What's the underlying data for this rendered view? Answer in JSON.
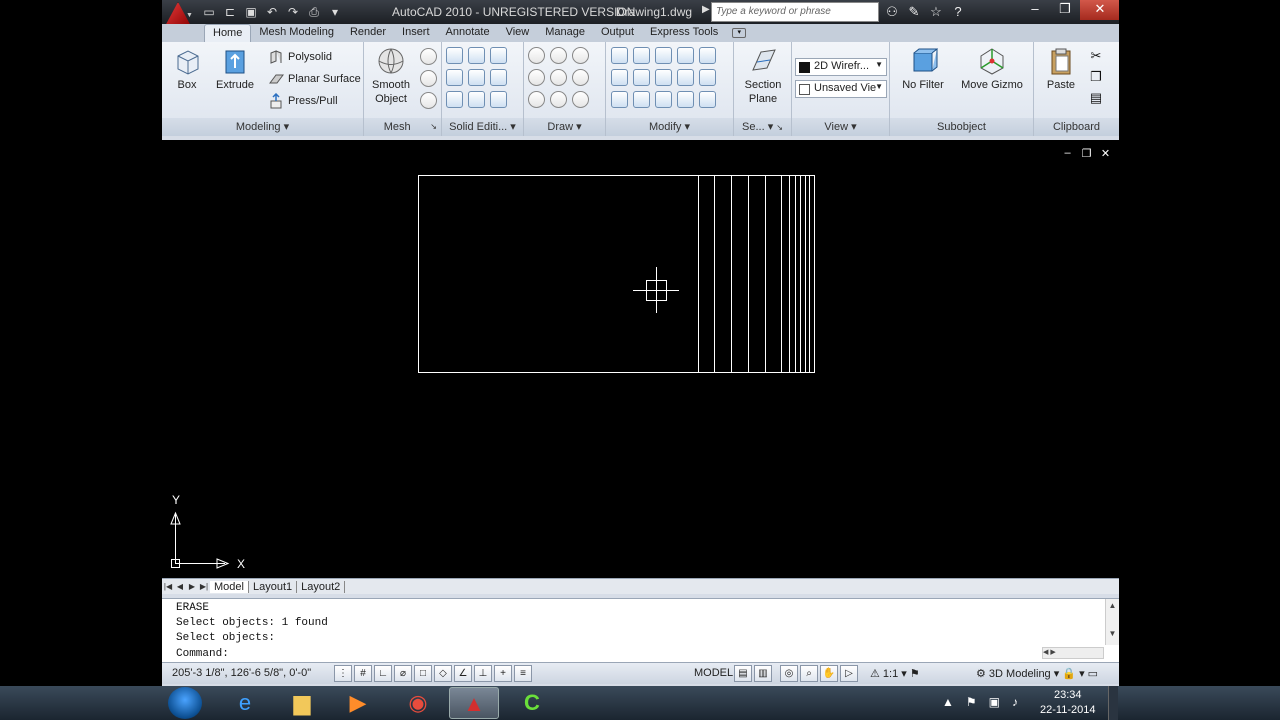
{
  "window": {
    "title": "AutoCAD 2010 - UNREGISTERED VERSION",
    "document": "Drawing1.dwg",
    "search_placeholder": "Type a keyword or phrase"
  },
  "tabs": [
    "Home",
    "Mesh Modeling",
    "Render",
    "Insert",
    "Annotate",
    "View",
    "Manage",
    "Output",
    "Express Tools"
  ],
  "ribbon": {
    "modeling": {
      "box": "Box",
      "extrude": "Extrude",
      "polysolid": "Polysolid",
      "planar_surface": "Planar Surface",
      "press_pull": "Press/Pull",
      "title": "Modeling"
    },
    "mesh": {
      "smooth1": "Smooth",
      "smooth2": "Object",
      "title": "Mesh"
    },
    "solid_editing": {
      "title": "Solid Editi..."
    },
    "draw": {
      "title": "Draw"
    },
    "modify": {
      "title": "Modify"
    },
    "section": {
      "label1": "Section",
      "label2": "Plane",
      "title": "Se..."
    },
    "view": {
      "visual_style": "2D Wirefr...",
      "named_view": "Unsaved Vie",
      "title": "View"
    },
    "subobject": {
      "no_filter": "No Filter",
      "move_gizmo": "Move Gizmo",
      "title": "Subobject"
    },
    "clipboard": {
      "paste": "Paste",
      "title": "Clipboard"
    }
  },
  "ucs": {
    "y": "Y",
    "x": "X"
  },
  "layout_tabs": [
    "Model",
    "Layout1",
    "Layout2"
  ],
  "command": {
    "history": [
      "ERASE",
      "Select objects: 1 found",
      "Select objects:"
    ],
    "prompt": "Command:"
  },
  "status": {
    "coords": "205'-3 1/8\", 126'-6 5/8\", 0'-0\"",
    "model": "MODEL",
    "scale": "1:1",
    "workspace": "3D Modeling"
  },
  "clock": {
    "time": "23:34",
    "date": "22-11-2014"
  },
  "colors": {
    "accent": "#cc1f1f",
    "ribbon_bg": "#dde4ee",
    "canvas": "#000000"
  }
}
